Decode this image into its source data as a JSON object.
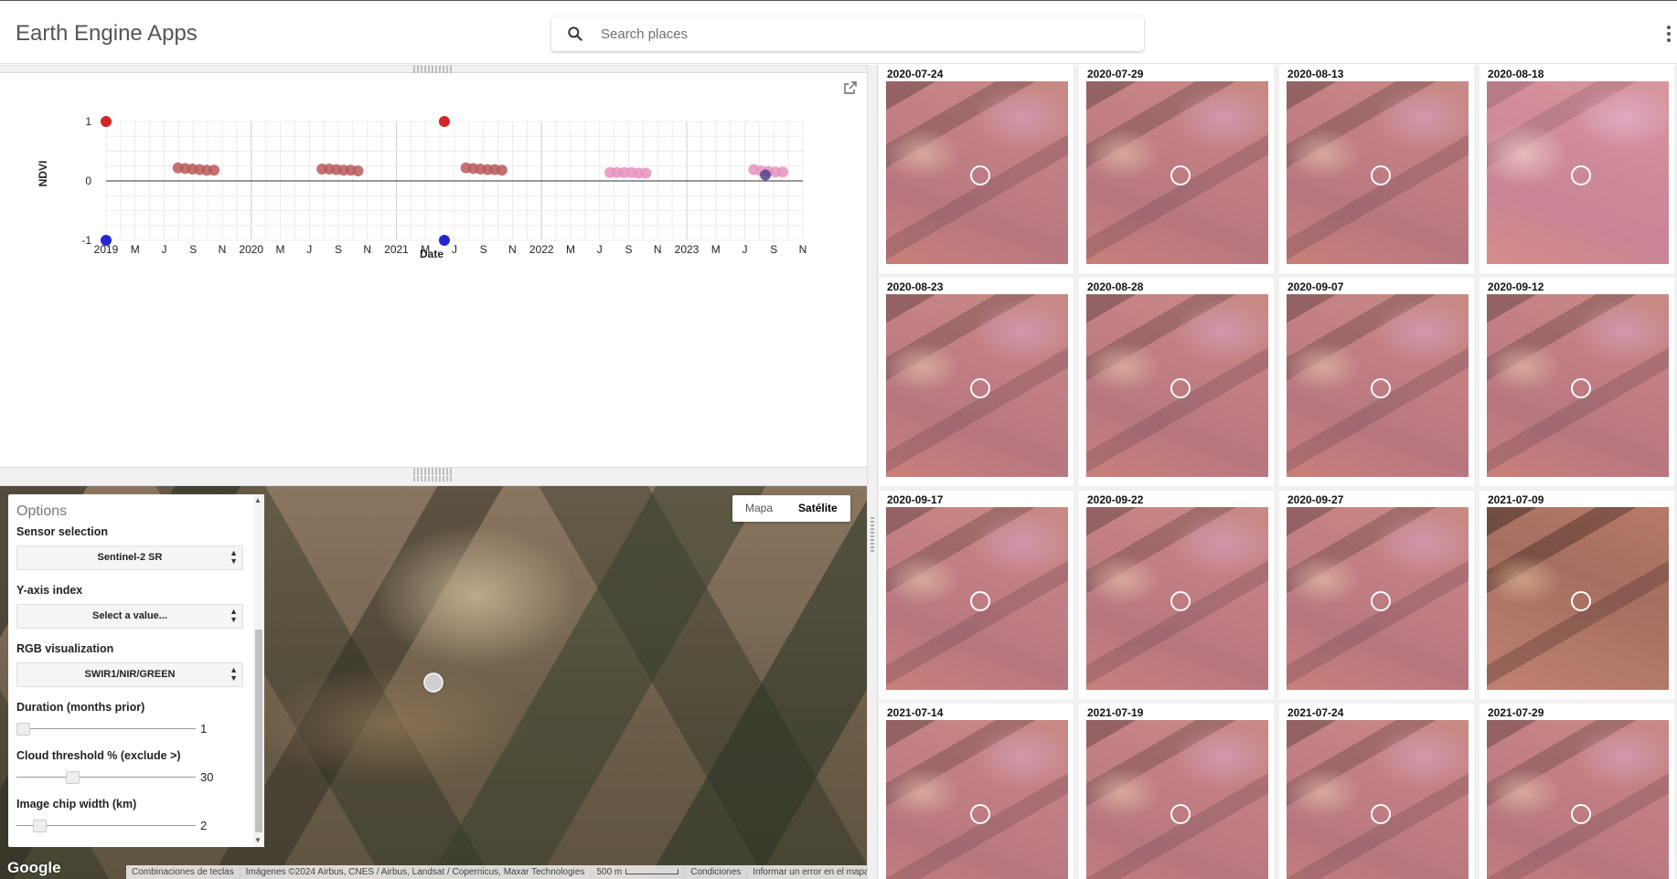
{
  "header": {
    "title": "Earth Engine Apps",
    "search_placeholder": "Search places"
  },
  "chart_data": {
    "type": "scatter",
    "ylabel": "NDVI",
    "xlabel": "Date",
    "ylim": [
      -1,
      1
    ],
    "y_ticks": [
      "1",
      "0",
      "-1"
    ],
    "x_ticks": [
      "2019",
      "M",
      "J",
      "S",
      "N",
      "2020",
      "M",
      "J",
      "S",
      "N",
      "2021",
      "M",
      "J",
      "S",
      "N",
      "2022",
      "M",
      "J",
      "S",
      "N",
      "2023",
      "M",
      "J",
      "S",
      "N"
    ],
    "grid": true,
    "series": [
      {
        "color": "#cc0000",
        "points": [
          [
            2019.0,
            1.0
          ],
          [
            2021.35,
            1.0
          ]
        ]
      },
      {
        "color": "#0000cc",
        "points": [
          [
            2019.0,
            -1.0
          ],
          [
            2021.35,
            -1.0
          ]
        ]
      },
      {
        "color": "#b85a5a",
        "points": [
          [
            2019.5,
            0.22
          ],
          [
            2019.55,
            0.21
          ],
          [
            2019.6,
            0.2
          ],
          [
            2019.65,
            0.19
          ],
          [
            2019.7,
            0.18
          ],
          [
            2019.75,
            0.18
          ]
        ]
      },
      {
        "color": "#b85a5a",
        "points": [
          [
            2020.5,
            0.2
          ],
          [
            2020.55,
            0.2
          ],
          [
            2020.6,
            0.19
          ],
          [
            2020.65,
            0.18
          ],
          [
            2020.7,
            0.18
          ],
          [
            2020.75,
            0.17
          ]
        ]
      },
      {
        "color": "#b85a5a",
        "points": [
          [
            2021.5,
            0.22
          ],
          [
            2021.55,
            0.21
          ],
          [
            2021.6,
            0.2
          ],
          [
            2021.65,
            0.19
          ],
          [
            2021.7,
            0.19
          ],
          [
            2021.75,
            0.18
          ]
        ]
      },
      {
        "color": "#e890c0",
        "points": [
          [
            2022.5,
            0.14
          ],
          [
            2022.55,
            0.14
          ],
          [
            2022.6,
            0.14
          ],
          [
            2022.65,
            0.14
          ],
          [
            2022.7,
            0.13
          ],
          [
            2022.75,
            0.13
          ]
        ]
      },
      {
        "color": "#e890c0",
        "points": [
          [
            2023.5,
            0.19
          ],
          [
            2023.55,
            0.17
          ],
          [
            2023.6,
            0.16
          ],
          [
            2023.65,
            0.15
          ],
          [
            2023.7,
            0.15
          ]
        ]
      },
      {
        "color": "#554488",
        "points": [
          [
            2023.58,
            0.1
          ]
        ]
      }
    ]
  },
  "map": {
    "type_buttons": [
      "Mapa",
      "Satélite"
    ],
    "active_type": "Satélite",
    "logo": "Google",
    "attribution": [
      "Combinaciones de teclas",
      "Imágenes ©2024 Airbus, CNES / Airbus, Landsat / Copernicus, Maxar Technologies",
      "500 m",
      "Condiciones",
      "Informar un error en el mapa"
    ]
  },
  "options": {
    "title": "Options",
    "sensor_label": "Sensor selection",
    "sensor_value": "Sentinel-2 SR",
    "yaxis_label": "Y-axis index",
    "yaxis_value": "Select a value...",
    "rgb_label": "RGB visualization",
    "rgb_value": "SWIR1/NIR/GREEN",
    "duration_label": "Duration (months prior)",
    "duration_value": "1",
    "duration_fraction": 0.0,
    "cloud_label": "Cloud threshold % (exclude >)",
    "cloud_value": "30",
    "cloud_fraction": 0.3,
    "chip_label": "Image chip width (km)",
    "chip_value": "2",
    "chip_fraction": 0.1
  },
  "chips": [
    {
      "date": "2020-07-24",
      "tone": "normal"
    },
    {
      "date": "2020-07-29",
      "tone": "normal"
    },
    {
      "date": "2020-08-13",
      "tone": "normal"
    },
    {
      "date": "2020-08-18",
      "tone": "light"
    },
    {
      "date": "2020-08-23",
      "tone": "normal"
    },
    {
      "date": "2020-08-28",
      "tone": "normal"
    },
    {
      "date": "2020-09-07",
      "tone": "normal"
    },
    {
      "date": "2020-09-12",
      "tone": "normal"
    },
    {
      "date": "2020-09-17",
      "tone": "normal"
    },
    {
      "date": "2020-09-22",
      "tone": "normal"
    },
    {
      "date": "2020-09-27",
      "tone": "normal"
    },
    {
      "date": "2021-07-09",
      "tone": "brown"
    },
    {
      "date": "2021-07-14",
      "tone": "normal"
    },
    {
      "date": "2021-07-19",
      "tone": "normal"
    },
    {
      "date": "2021-07-24",
      "tone": "normal"
    },
    {
      "date": "2021-07-29",
      "tone": "normal"
    }
  ]
}
